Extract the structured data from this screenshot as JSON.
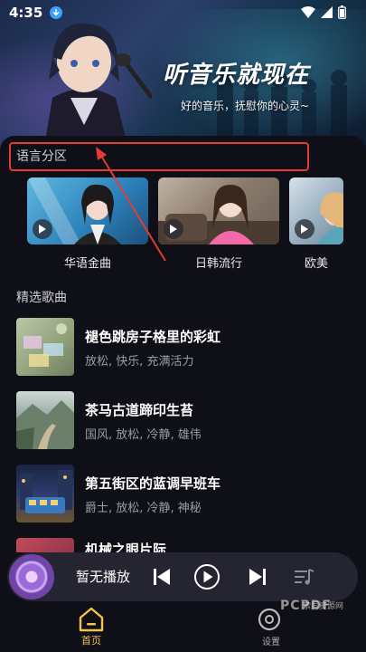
{
  "status_bar": {
    "time": "4:35"
  },
  "hero": {
    "title": "听音乐就现在",
    "subtitle": "好的音乐，抚慰你的心灵~"
  },
  "language_section": {
    "title": "语言分区",
    "items": [
      {
        "label": "华语金曲"
      },
      {
        "label": "日韩流行"
      },
      {
        "label": "欧美"
      }
    ]
  },
  "featured_section": {
    "title": "精选歌曲",
    "songs": [
      {
        "name": "褪色跳房子格里的彩虹",
        "tags": "放松, 快乐, 充满活力"
      },
      {
        "name": "茶马古道蹄印生苔",
        "tags": "国风, 放松, 冷静, 雄伟"
      },
      {
        "name": "第五街区的蓝调早班车",
        "tags": "爵士, 放松, 冷静, 神秘"
      },
      {
        "name": "机械之眼片际"
      }
    ]
  },
  "player": {
    "now_playing": "暂无播放"
  },
  "bottom_nav": {
    "home_label": "首页",
    "me_label": "设置"
  },
  "watermark": {
    "brand": "PCPDF",
    "site": "索同资源网"
  },
  "colors": {
    "accent": "#f2c24a",
    "annotation": "#e23c34",
    "background": "#0f1017"
  }
}
